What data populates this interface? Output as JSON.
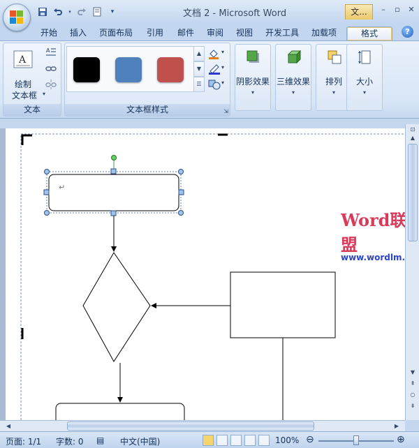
{
  "window": {
    "title": "文档 2 - Microsoft Word",
    "context_tab_group": "文..."
  },
  "tabs": [
    {
      "label": "开始"
    },
    {
      "label": "插入"
    },
    {
      "label": "页面布局"
    },
    {
      "label": "引用"
    },
    {
      "label": "邮件"
    },
    {
      "label": "审阅"
    },
    {
      "label": "视图"
    },
    {
      "label": "开发工具"
    },
    {
      "label": "加载项"
    },
    {
      "label": "格式",
      "active": true
    }
  ],
  "ribbon": {
    "text_group": {
      "label": "文本",
      "draw_textbox": "绘制\n文本框",
      "draw_textbox_l1": "绘制",
      "draw_textbox_l2": "文本框"
    },
    "textbox_styles_group": {
      "label": "文本框样式",
      "swatches": [
        "#000000",
        "#4f81bd",
        "#c0504d"
      ]
    },
    "shadow_effects": "阴影效果",
    "effects_3d": "三维效果",
    "arrange": "排列",
    "size": "大小"
  },
  "document": {
    "paragraph_mark": "↵"
  },
  "watermark": {
    "brand": "Word联盟",
    "url": "www.wordlm.com"
  },
  "status": {
    "page": "页面: 1/1",
    "words": "字数: 0",
    "language": "中文(中国)",
    "zoom": "100%"
  },
  "colors": {
    "accent_orange": "#ecc86a",
    "ribbon_blue": "#c2d6ef"
  }
}
